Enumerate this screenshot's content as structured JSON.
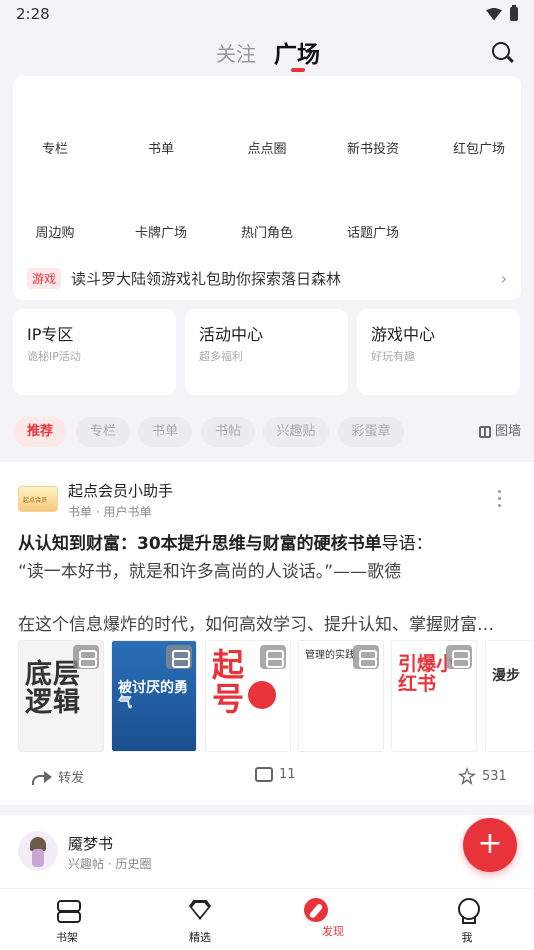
{
  "status": {
    "time": "2:28"
  },
  "header": {
    "tab_follow": "关注",
    "tab_square": "广场"
  },
  "grid": {
    "row1": [
      "专栏",
      "书单",
      "点点圈",
      "新书投资",
      "红包广场"
    ],
    "row2": [
      "周边购",
      "卡牌广场",
      "热门角色",
      "话题广场"
    ]
  },
  "banner": {
    "tag": "游戏",
    "text": "读斗罗大陆领游戏礼包助你探索落日森林",
    "arrow": "›"
  },
  "zones": [
    {
      "title": "IP专区",
      "subtitle": "诡秘IP活动"
    },
    {
      "title": "活动中心",
      "subtitle": "超多福利"
    },
    {
      "title": "游戏中心",
      "subtitle": "好玩有趣"
    }
  ],
  "chips": [
    "推荐",
    "专栏",
    "书单",
    "书帖",
    "兴趣贴",
    "彩蛋章"
  ],
  "wall_label": "图墙",
  "post1": {
    "avatar_text": "起点会员",
    "author": "起点会员小助手",
    "meta": "书单 · 用户书单",
    "title_bold": "从认知到财富：30本提升思维与财富的硬核书单",
    "title_suffix": "导语：",
    "quote": "“读一本好书，就是和许多高尚的人谈话。”——歌德",
    "body": "在这个信息爆炸的时代，如何高效学习、提升认知、掌握财富…",
    "books": [
      "底层逻辑",
      "被讨厌的勇气",
      "起号",
      "管理的实践",
      "引爆小红书",
      "漫步"
    ],
    "share_label": "转发",
    "comments": "11",
    "likes": "531"
  },
  "post2": {
    "author": "魇梦书",
    "meta": "兴趣帖 · 历史圈"
  },
  "fab": "+",
  "bottom_nav": [
    "书架",
    "精选",
    "发现",
    "我"
  ],
  "colors": {
    "accent": "#e8333b",
    "background": "#f4f4f6"
  }
}
